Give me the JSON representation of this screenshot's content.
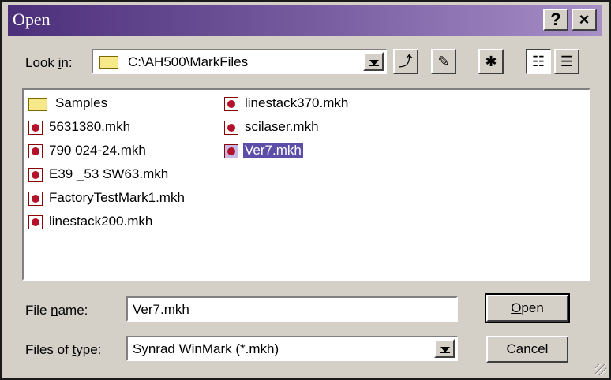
{
  "window": {
    "title": "Open",
    "help_label": "?",
    "close_label": "×"
  },
  "look_in": {
    "label_pre": "Look ",
    "label_u": "i",
    "label_post": "n:",
    "value": "C:\\AH500\\MarkFiles"
  },
  "toolbar": {
    "icons": [
      "up-folder-icon",
      "desktop-icon",
      "new-folder-icon",
      "list-view-icon",
      "details-view-icon"
    ]
  },
  "files": [
    {
      "name": "Samples",
      "type": "folder"
    },
    {
      "name": "5631380.mkh",
      "type": "mkh"
    },
    {
      "name": "790 024-24.mkh",
      "type": "mkh"
    },
    {
      "name": "E39 _53 SW63.mkh",
      "type": "mkh"
    },
    {
      "name": "FactoryTestMark1.mkh",
      "type": "mkh"
    },
    {
      "name": "linestack200.mkh",
      "type": "mkh"
    },
    {
      "name": "linestack370.mkh",
      "type": "mkh"
    },
    {
      "name": "scilaser.mkh",
      "type": "mkh"
    },
    {
      "name": "Ver7.mkh",
      "type": "mkh",
      "selected": true
    }
  ],
  "file_name": {
    "label_pre": "File ",
    "label_u": "n",
    "label_post": "ame:",
    "value": "Ver7.mkh"
  },
  "file_type": {
    "label_pre": "Files of ",
    "label_u": "t",
    "label_post": "ype:",
    "value": "Synrad  WinMark (*.mkh)"
  },
  "buttons": {
    "open_u": "O",
    "open_rest": "pen",
    "cancel": "Cancel"
  }
}
